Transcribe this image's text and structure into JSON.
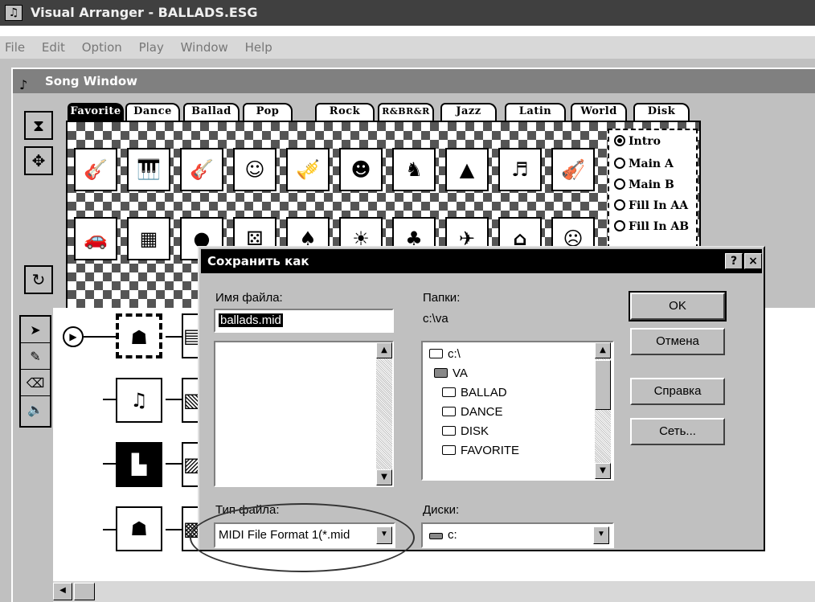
{
  "app": {
    "title": "Visual Arranger - BALLADS.ESG",
    "menu": [
      "File",
      "Edit",
      "Option",
      "Play",
      "Window",
      "Help"
    ]
  },
  "song_window": {
    "title": "Song Window",
    "tabs": [
      "Favorite",
      "Dance",
      "Ballad",
      "Pop",
      "Rock",
      "R&BR&R",
      "Jazz",
      "Latin",
      "World",
      "Disk"
    ],
    "active_tab": "Favorite",
    "sections": [
      {
        "label": "Intro",
        "selected": true
      },
      {
        "label": "Main A",
        "selected": false
      },
      {
        "label": "Main B",
        "selected": false
      },
      {
        "label": "Fill In AA",
        "selected": false
      },
      {
        "label": "Fill In AB",
        "selected": false
      }
    ]
  },
  "dialog": {
    "title": "Сохранить как",
    "help_btn": "?",
    "close_btn": "×",
    "filename_label": "Имя файла:",
    "filename_value": "ballads.mid",
    "folders_label": "Папки:",
    "current_path": "c:\\va",
    "folders": [
      {
        "name": "c:\\",
        "icon": "open-folder-icon"
      },
      {
        "name": "VA",
        "icon": "open-folder-icon"
      },
      {
        "name": "BALLAD",
        "icon": "folder-icon"
      },
      {
        "name": "DANCE",
        "icon": "folder-icon"
      },
      {
        "name": "DISK",
        "icon": "folder-icon"
      },
      {
        "name": "FAVORITE",
        "icon": "folder-icon"
      }
    ],
    "filetype_label": "Тип файла:",
    "filetype_value": "MIDI File Format 1(*.mid",
    "drives_label": "Диски:",
    "drives_value": "c:",
    "ok": "OK",
    "cancel": "Отмена",
    "help": "Справка",
    "network": "Сеть..."
  }
}
